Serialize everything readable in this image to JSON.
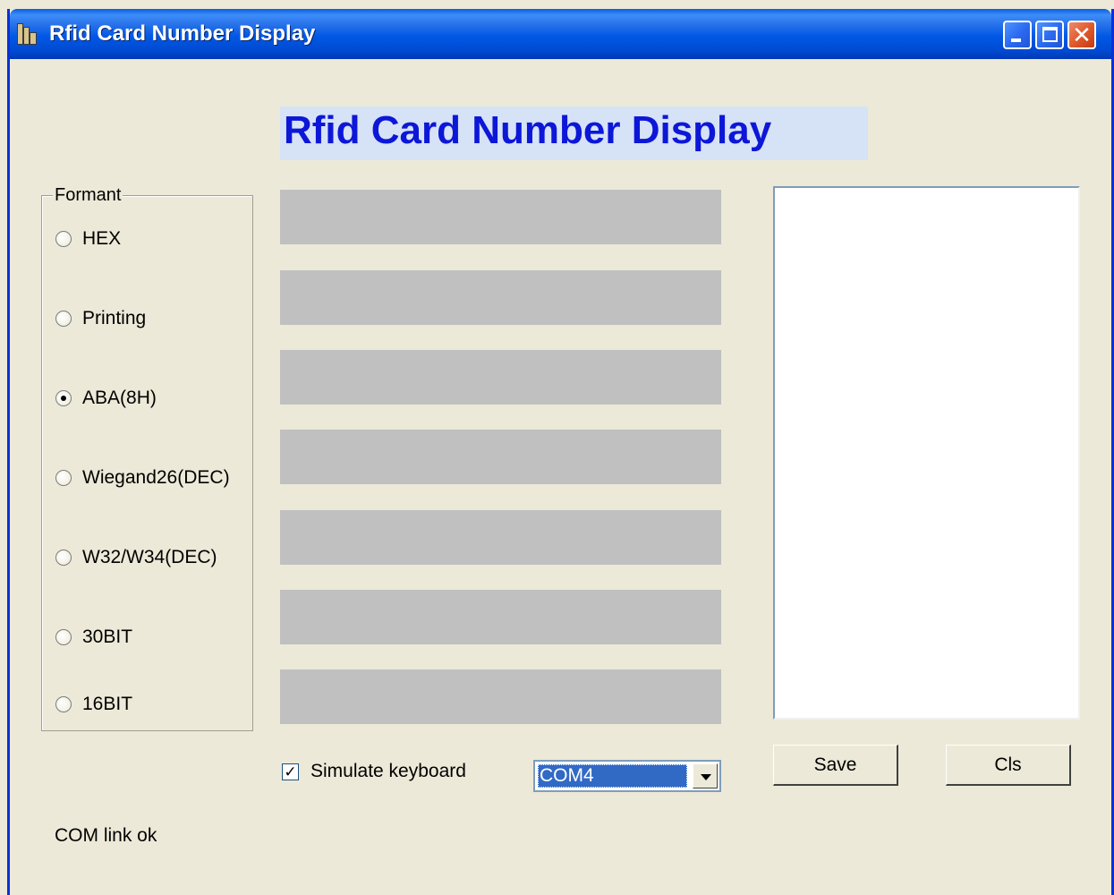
{
  "window": {
    "title": "Rfid Card Number Display",
    "icon": "app-icon"
  },
  "heading": "Rfid Card Number Display",
  "format_group": {
    "legend": "Formant",
    "options": [
      {
        "label": "HEX",
        "checked": false
      },
      {
        "label": "Printing",
        "checked": false
      },
      {
        "label": "ABA(8H)",
        "checked": true
      },
      {
        "label": "Wiegand26(DEC)",
        "checked": false
      },
      {
        "label": "W32/W34(DEC)",
        "checked": false
      },
      {
        "label": "30BIT",
        "checked": false
      },
      {
        "label": "16BIT",
        "checked": false
      }
    ]
  },
  "display_fields": [
    "",
    "",
    "",
    "",
    "",
    "",
    ""
  ],
  "simulate_keyboard": {
    "label": "Simulate keyboard",
    "checked": true
  },
  "port_select": {
    "value": "COM4"
  },
  "buttons": {
    "save": "Save",
    "cls": "Cls"
  },
  "status": "COM link ok",
  "colors": {
    "heading_text": "#0c17d8",
    "heading_bg": "#d6e2f6",
    "field_bg": "#c0c0c0",
    "dialog_bg": "#ece9d8"
  }
}
